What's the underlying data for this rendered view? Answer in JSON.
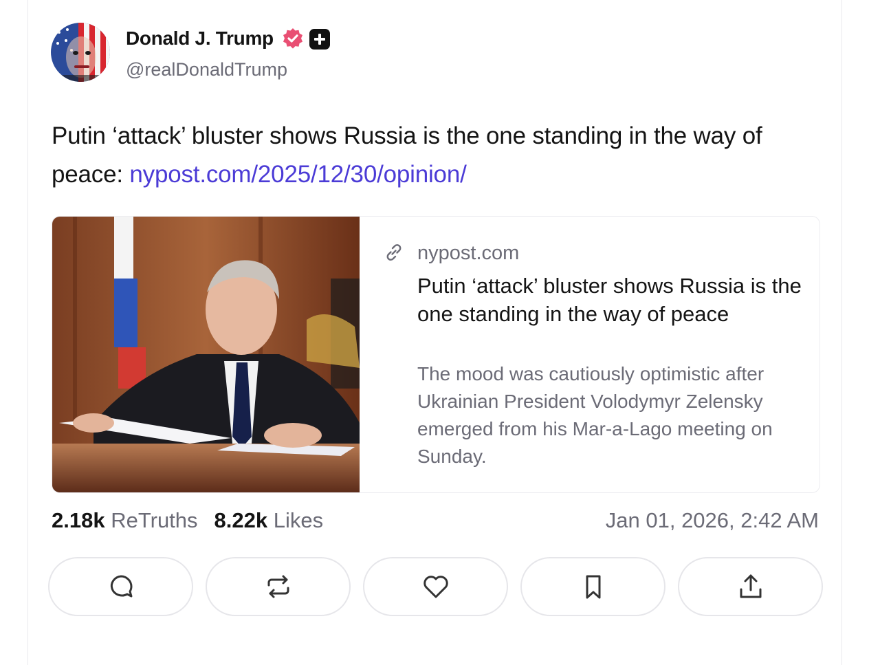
{
  "author": {
    "display_name": "Donald J. Trump",
    "handle": "@realDonaldTrump",
    "verified_color": "#e94f73"
  },
  "post": {
    "text": "Putin ‘attack’ bluster shows Russia is the one standing in the way of peace: ",
    "link_text": "nypost.com/2025/12/30/opinion/",
    "link_color": "#4b3bd6"
  },
  "card": {
    "domain": "nypost.com",
    "title": "Putin ‘attack’ bluster shows Russia is the one standing in the way of peace",
    "description": "The mood was cautiously optimistic after Ukrainian President Volodymyr Zelensky emerged from his Mar-a-Lago meeting on Sunday.",
    "image_icon": "photo"
  },
  "stats": {
    "retruths_count": "2.18k",
    "retruths_label": "ReTruths",
    "likes_count": "8.22k",
    "likes_label": "Likes",
    "timestamp": "Jan 01, 2026, 2:42 AM"
  },
  "actions": [
    {
      "name": "reply",
      "icon": "comment-icon"
    },
    {
      "name": "retruth",
      "icon": "repost-icon"
    },
    {
      "name": "like",
      "icon": "heart-icon"
    },
    {
      "name": "bookmark",
      "icon": "bookmark-icon"
    },
    {
      "name": "share",
      "icon": "share-icon"
    }
  ]
}
